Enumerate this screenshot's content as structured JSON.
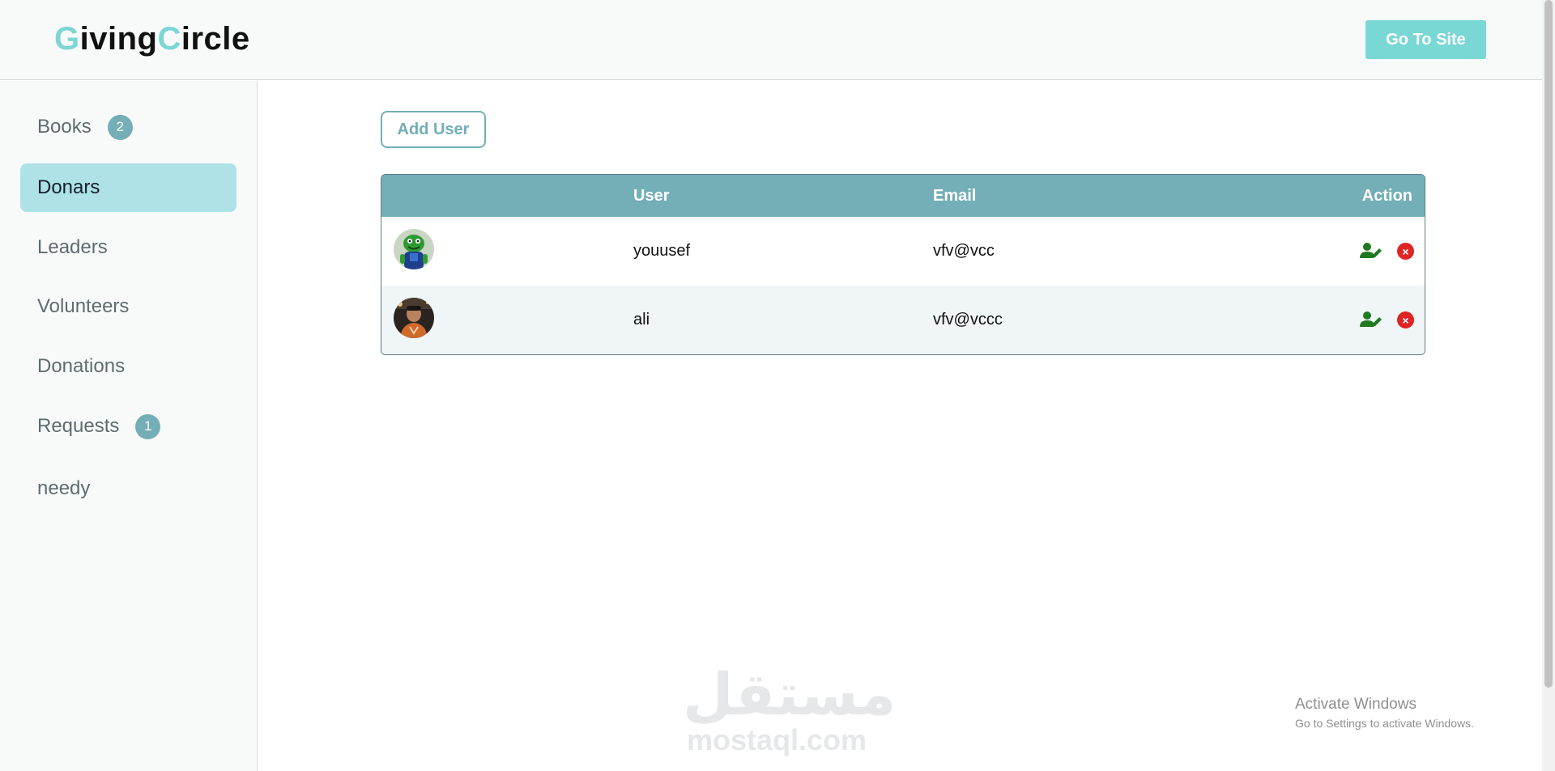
{
  "header": {
    "logo": {
      "part1_initial": "G",
      "part1_rest": "iving",
      "part2_initial": "C",
      "part2_rest": "ircle"
    },
    "go_to_site": "Go To Site",
    "accent_color": "#79d7d4"
  },
  "sidebar": {
    "items": [
      {
        "label": "Books",
        "badge": "2"
      },
      {
        "label": "Donars",
        "active": true
      },
      {
        "label": "Leaders"
      },
      {
        "label": "Volunteers"
      },
      {
        "label": "Donations"
      },
      {
        "label": "Requests",
        "badge": "1"
      },
      {
        "label": "needy"
      }
    ]
  },
  "main": {
    "add_user_label": "Add User",
    "table": {
      "columns": [
        "",
        "User",
        "Email",
        "Action"
      ],
      "rows": [
        {
          "user": "youusef",
          "email": "vfv@vcc",
          "avatar": "green-character-avatar"
        },
        {
          "user": "ali",
          "email": "vfv@vccc",
          "avatar": "person-photo-avatar"
        }
      ],
      "header_color": "#74aeb7"
    }
  },
  "watermark": {
    "arabic": "مستقل",
    "latin": "mostaql.com"
  },
  "os_notice": {
    "title": "Activate Windows",
    "subtitle": "Go to Settings to activate Windows."
  }
}
